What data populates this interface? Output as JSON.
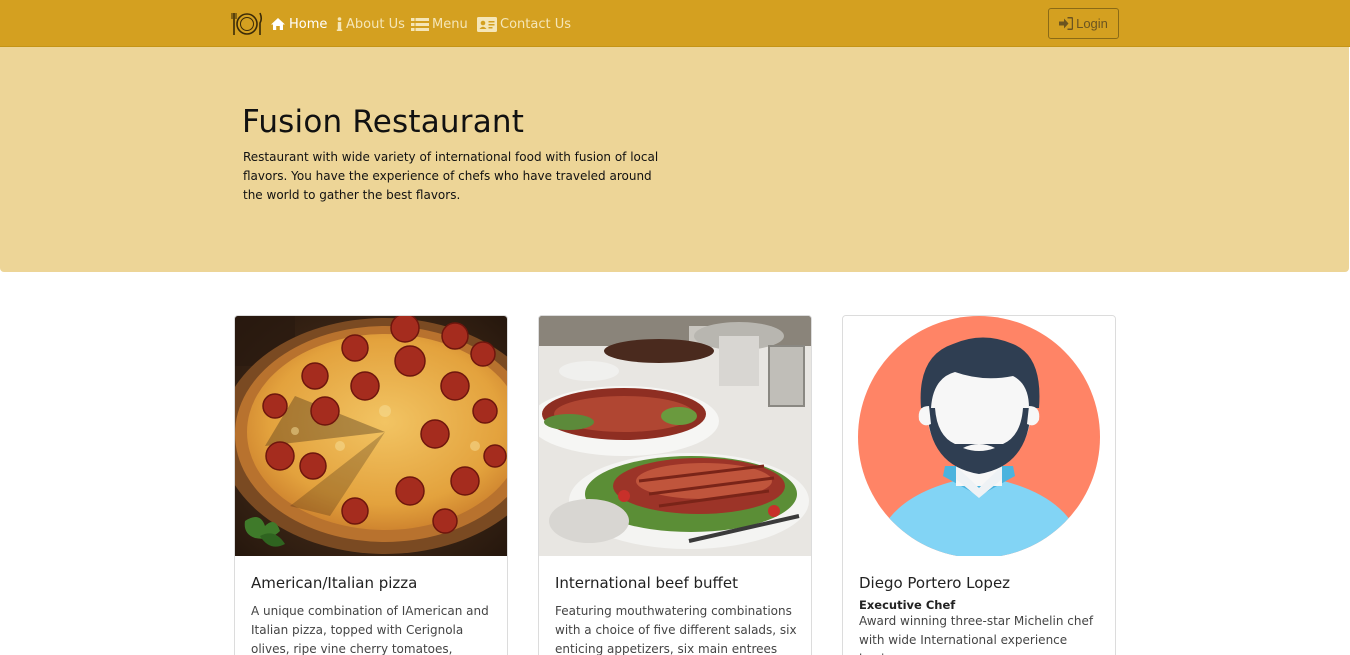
{
  "navbar": {
    "bg_color": "#D4A020",
    "brand_icon": "plate-cutlery-icon",
    "items": [
      {
        "label": "Home",
        "icon": "home-icon",
        "active": true
      },
      {
        "label": "About Us",
        "icon": "info-icon",
        "active": false
      },
      {
        "label": "Menu",
        "icon": "list-icon",
        "active": false
      },
      {
        "label": "Contact Us",
        "icon": "address-card-icon",
        "active": false
      }
    ],
    "login_label": "Login",
    "login_icon": "sign-in-icon"
  },
  "jumbotron": {
    "bg_color": "#EDD597",
    "title": "Fusion Restaurant",
    "description": "Restaurant with wide variety of international food with fusion of local flavors. You have the experience of chefs who have traveled around the world to gather the best flavors."
  },
  "cards": [
    {
      "title": "American/Italian pizza",
      "text": "A unique combination of IAmerican and Italian pizza, topped with Cerignola olives, ripe vine cherry tomatoes, Vidalia onion,",
      "image": "pepperoni-pizza-photo"
    },
    {
      "title": "International beef buffet",
      "text": "Featuring mouthwatering combinations with a choice of five different salads, six enticing appetizers, six main entrees and",
      "image": "beef-buffet-photo"
    },
    {
      "title": "Diego Portero Lopez",
      "subtitle": "Executive Chef",
      "text": "Award winning three-star Michelin chef with wide International experience having",
      "image": "chef-avatar-illustration"
    }
  ]
}
